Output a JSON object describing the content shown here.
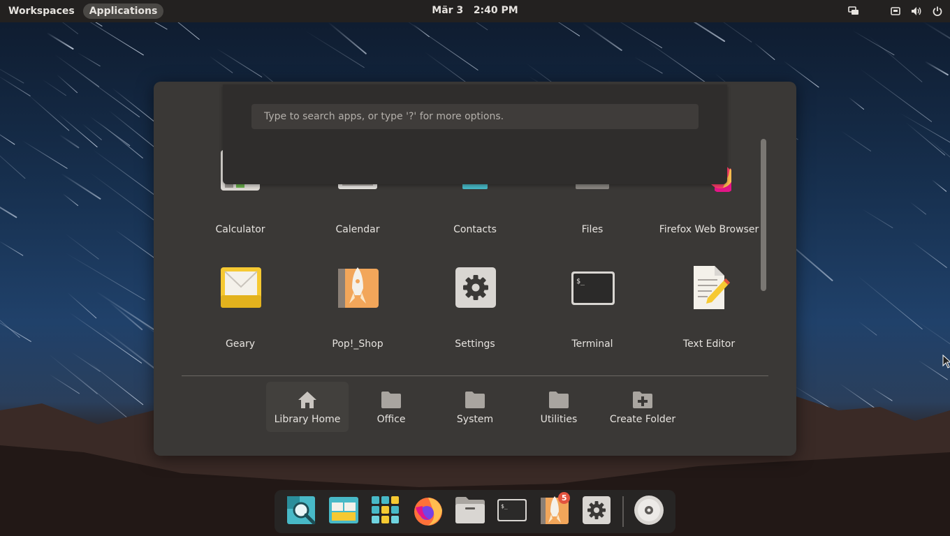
{
  "topbar": {
    "workspaces_label": "Workspaces",
    "applications_label": "Applications",
    "date": "Mär 3",
    "time": "2:40 PM",
    "right_icons": [
      "screen-share-icon",
      "keyboard-icon",
      "volume-icon",
      "power-icon"
    ]
  },
  "launcher": {
    "search_placeholder": "Type to search apps, or type '?' for more options.",
    "apps": [
      {
        "label": "Calculator",
        "icon": "calculator-icon"
      },
      {
        "label": "Calendar",
        "icon": "calendar-icon"
      },
      {
        "label": "Contacts",
        "icon": "contacts-icon"
      },
      {
        "label": "Files",
        "icon": "files-icon"
      },
      {
        "label": "Firefox Web Browser",
        "icon": "firefox-icon"
      },
      {
        "label": "Geary",
        "icon": "mail-icon"
      },
      {
        "label": "Pop!_Shop",
        "icon": "pop-shop-icon"
      },
      {
        "label": "Settings",
        "icon": "settings-gear-icon"
      },
      {
        "label": "Terminal",
        "icon": "terminal-icon"
      },
      {
        "label": "Text Editor",
        "icon": "text-editor-icon"
      }
    ],
    "folders": [
      {
        "label": "Library Home",
        "icon": "home-icon"
      },
      {
        "label": "Office",
        "icon": "folder-icon"
      },
      {
        "label": "System",
        "icon": "folder-icon"
      },
      {
        "label": "Utilities",
        "icon": "folder-icon"
      },
      {
        "label": "Create Folder",
        "icon": "folder-plus-icon"
      }
    ]
  },
  "dock": {
    "items": [
      "search-magnifier-icon",
      "window-tiling-icon",
      "app-grid-icon",
      "firefox-icon",
      "files-icon",
      "terminal-icon",
      "pop-shop-icon",
      "settings-gear-icon",
      "optical-disc-icon"
    ],
    "shop_badge": "5",
    "terminal_prompt": "$_"
  },
  "colors": {
    "panel_bg": "#3a3836",
    "topbar_bg": "#232120",
    "accent_teal": "#48b9c7",
    "accent_orange": "#faa41a"
  }
}
